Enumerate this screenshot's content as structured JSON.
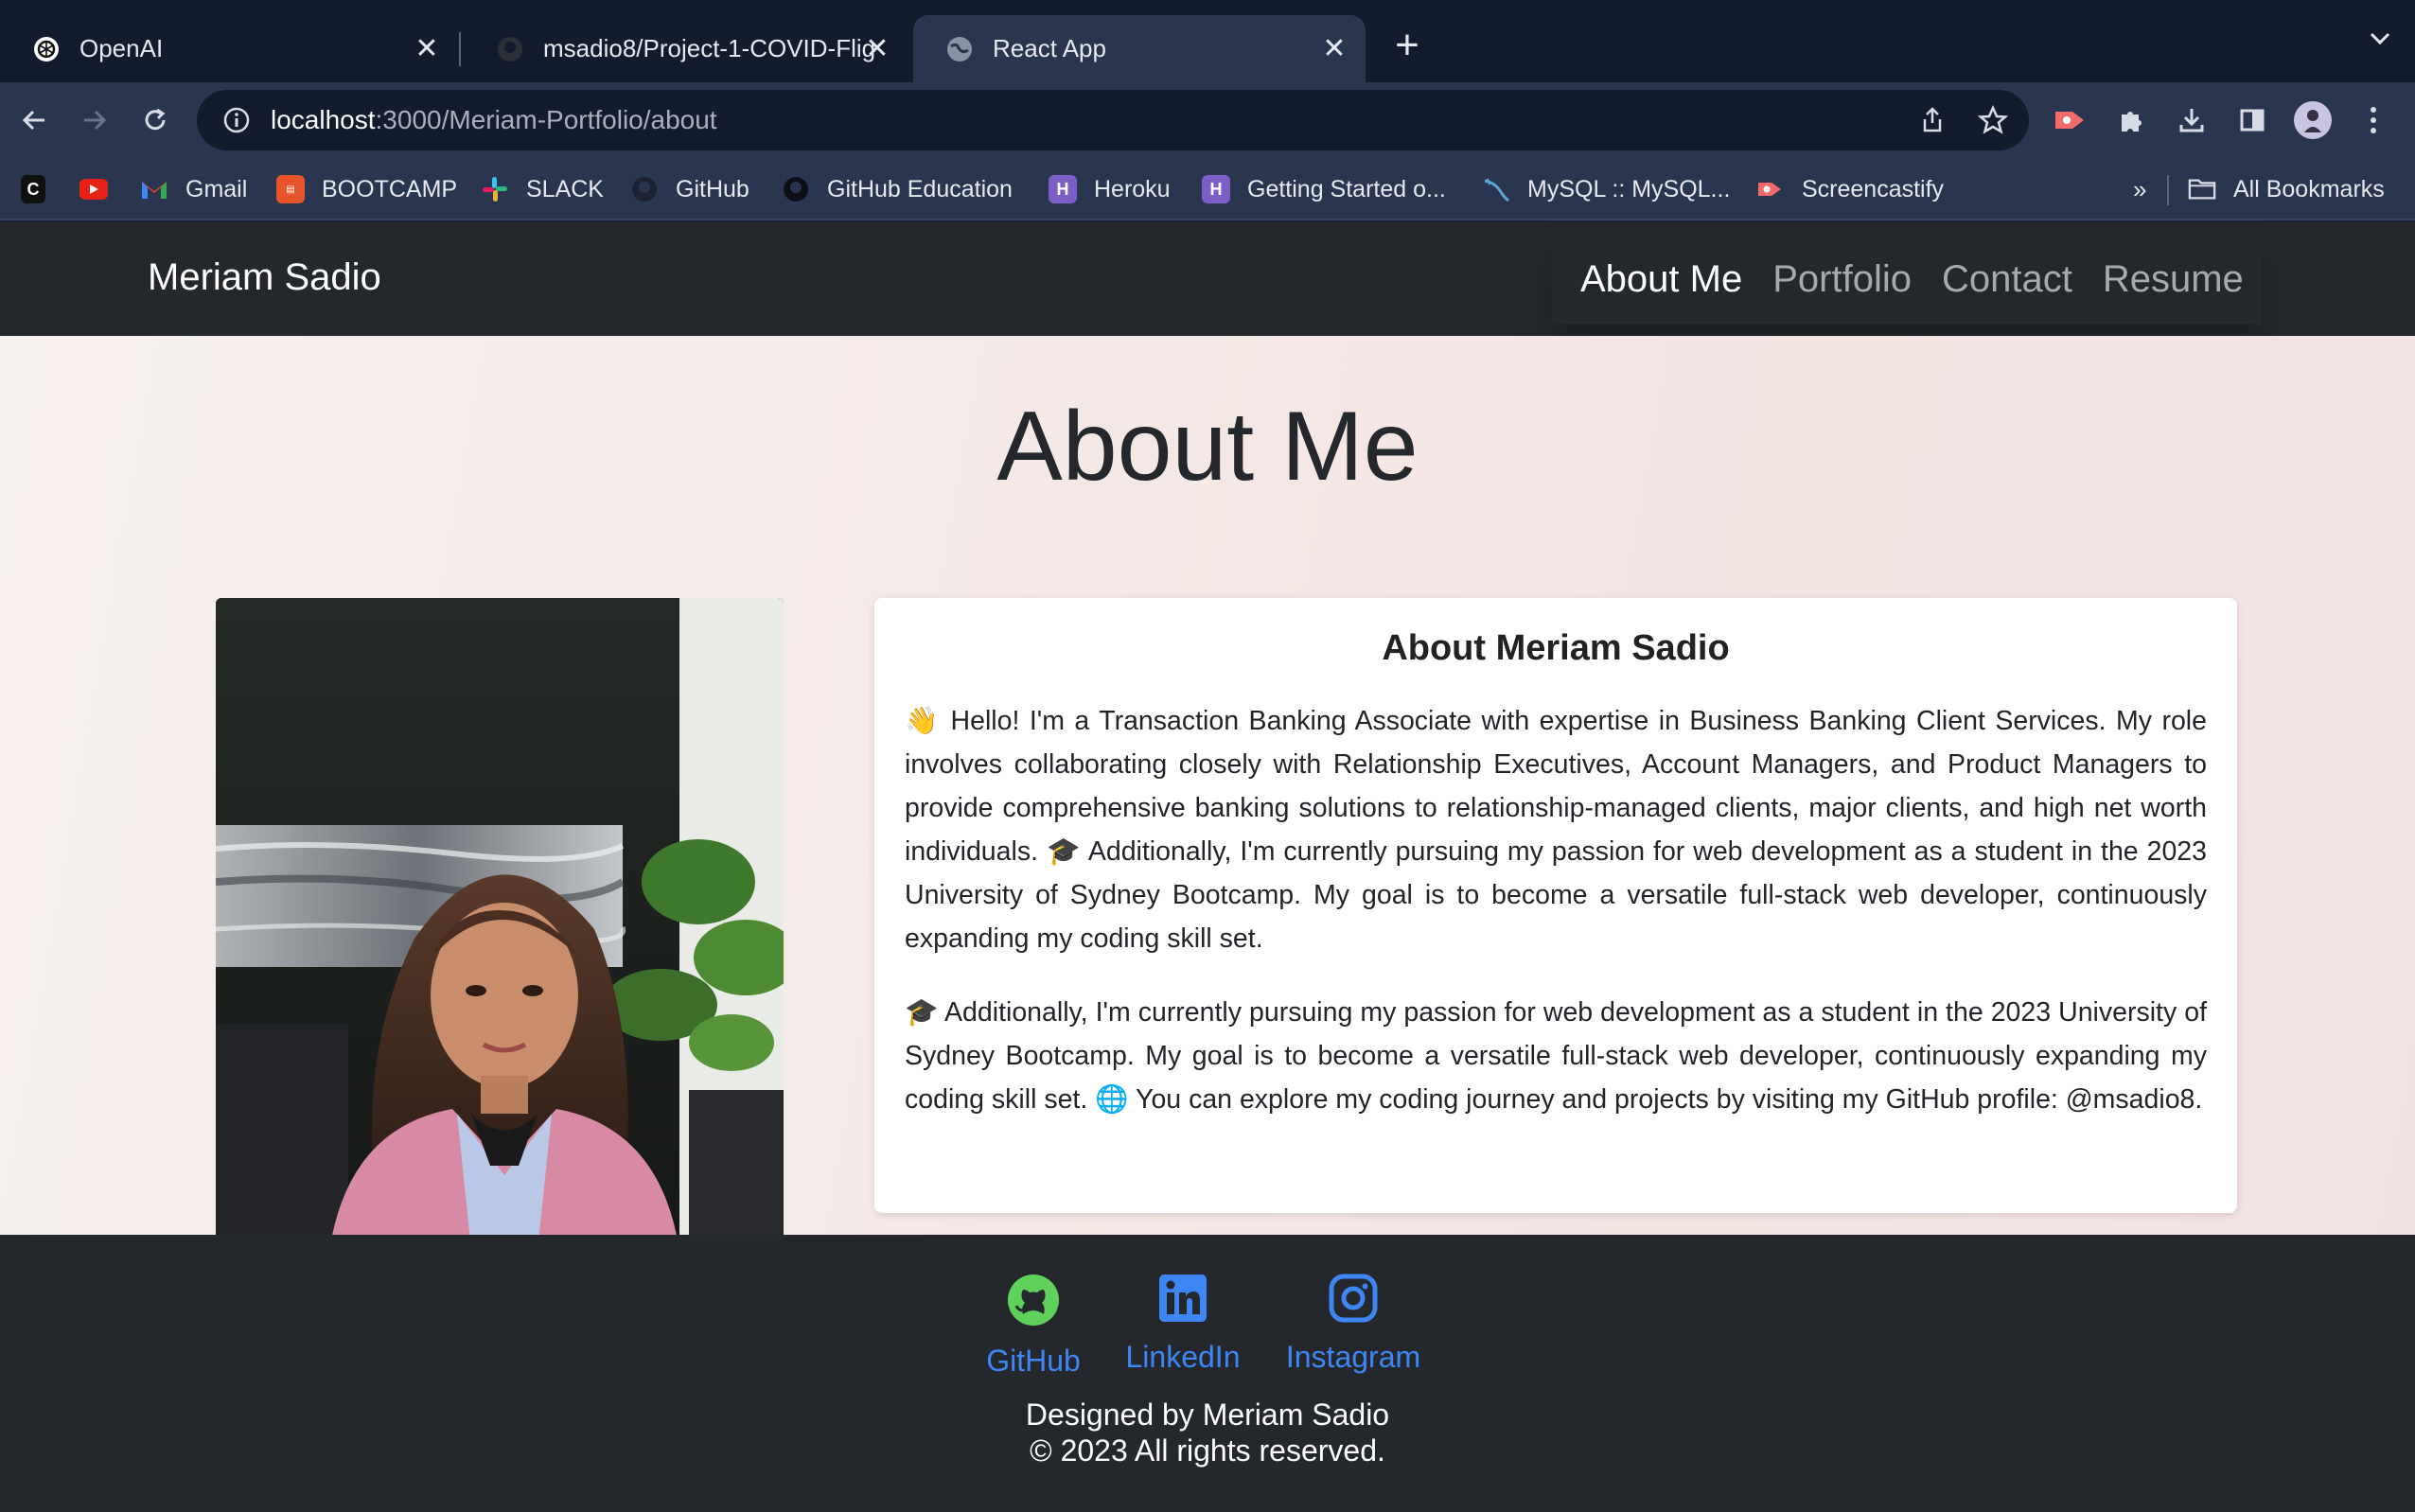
{
  "browser": {
    "tabs": [
      {
        "title": "OpenAI",
        "icon": "openai-icon",
        "active": false
      },
      {
        "title": "msadio8/Project-1-COVID-Flig",
        "icon": "github-icon",
        "active": false
      },
      {
        "title": "React App",
        "icon": "globe-icon",
        "active": true
      }
    ],
    "url_host": "localhost",
    "url_path": ":3000/Meriam-Portfolio/about",
    "bookmarks": [
      {
        "label": "",
        "icon": "c-icon"
      },
      {
        "label": "",
        "icon": "youtube-icon"
      },
      {
        "label": "Gmail",
        "icon": "gmail-icon"
      },
      {
        "label": "BOOTCAMP",
        "icon": "bootcamp-icon"
      },
      {
        "label": "SLACK",
        "icon": "slack-icon"
      },
      {
        "label": "GitHub",
        "icon": "github-icon"
      },
      {
        "label": "GitHub Education",
        "icon": "github-icon"
      },
      {
        "label": "Heroku",
        "icon": "heroku-icon"
      },
      {
        "label": "Getting Started o...",
        "icon": "heroku-icon"
      },
      {
        "label": "MySQL :: MySQL...",
        "icon": "mysql-icon"
      },
      {
        "label": "Screencastify",
        "icon": "screencastify-icon"
      }
    ],
    "bookmarks_overflow": "»",
    "all_bookmarks": "All Bookmarks"
  },
  "site": {
    "brand": "Meriam Sadio",
    "nav": [
      {
        "label": "About Me",
        "active": true
      },
      {
        "label": "Portfolio",
        "active": false
      },
      {
        "label": "Contact",
        "active": false
      },
      {
        "label": "Resume",
        "active": false
      }
    ]
  },
  "about": {
    "heading": "About Me",
    "card_title": "About Meriam Sadio",
    "paragraph1": "👋 Hello! I'm a Transaction Banking Associate with expertise in Business Banking Client Services. My role involves collaborating closely with Relationship Executives, Account Managers, and Product Managers to provide comprehensive banking solutions to relationship-managed clients, major clients, and high net worth individuals. 🎓 Additionally, I'm currently pursuing my passion for web development as a student in the 2023 University of Sydney Bootcamp. My goal is to become a versatile full-stack web developer, continuously expanding my coding skill set.",
    "paragraph2": "🎓 Additionally, I'm currently pursuing my passion for web development as a student in the 2023 University of Sydney Bootcamp. My goal is to become a versatile full-stack web developer, continuously expanding my coding skill set. 🌐 You can explore my coding journey and projects by visiting my GitHub profile: @msadio8."
  },
  "footer": {
    "links": [
      {
        "label": "GitHub",
        "icon": "github-icon"
      },
      {
        "label": "LinkedIn",
        "icon": "linkedin-icon"
      },
      {
        "label": "Instagram",
        "icon": "instagram-icon"
      }
    ],
    "designed_by": "Designed by Meriam Sadio",
    "copyright": "© 2023 All rights reserved."
  },
  "colors": {
    "chrome_bg": "#131b2e",
    "toolbar_bg": "#2a3550",
    "site_nav_bg": "#24282d",
    "link_blue": "#3f86f5",
    "github_green": "#5fd05a"
  }
}
